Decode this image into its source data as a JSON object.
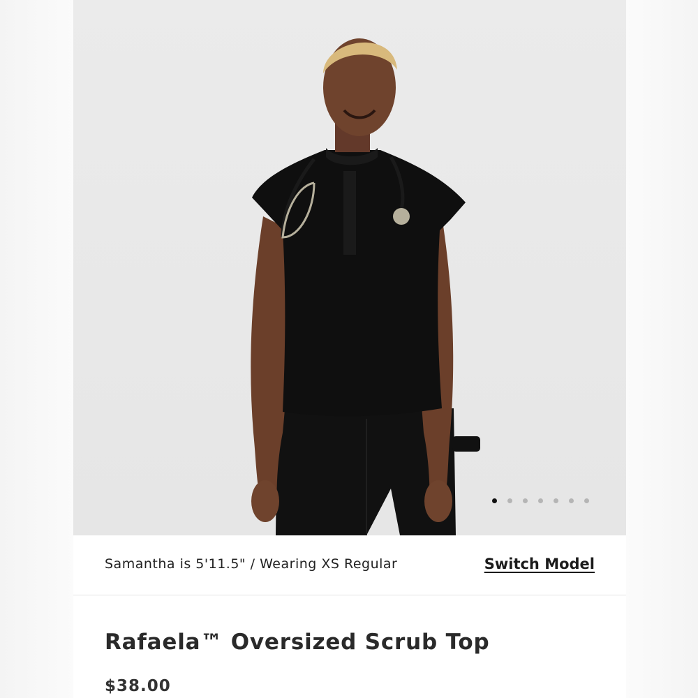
{
  "gallery": {
    "image_alt": "Model wearing black oversized scrub top with stethoscope",
    "slide_count": 7,
    "active_slide": 1
  },
  "model_info": {
    "note": "Samantha is 5'11.5\" / Wearing XS Regular",
    "switch_label": "Switch Model"
  },
  "product": {
    "title": "Rafaela™ Oversized Scrub Top",
    "price": "$38.00"
  }
}
